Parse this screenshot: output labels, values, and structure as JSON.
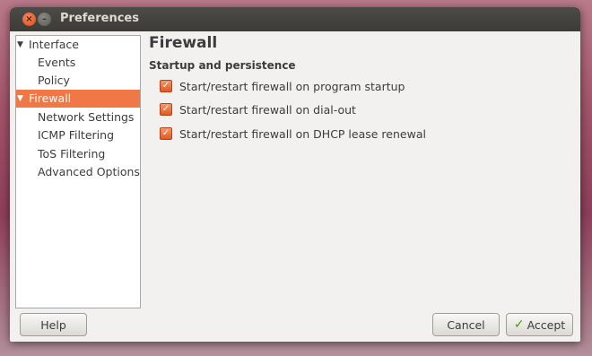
{
  "window": {
    "title": "Preferences"
  },
  "sidebar": {
    "items": [
      {
        "label": "Interface",
        "level": 0,
        "expanded": true,
        "selected": false
      },
      {
        "label": "Events",
        "level": 1,
        "selected": false
      },
      {
        "label": "Policy",
        "level": 1,
        "selected": false
      },
      {
        "label": "Firewall",
        "level": 0,
        "expanded": true,
        "selected": true
      },
      {
        "label": "Network Settings",
        "level": 1,
        "selected": false
      },
      {
        "label": "ICMP Filtering",
        "level": 1,
        "selected": false
      },
      {
        "label": "ToS Filtering",
        "level": 1,
        "selected": false
      },
      {
        "label": "Advanced Options",
        "level": 1,
        "selected": false
      }
    ],
    "expander_icon": "triangle-down-icon"
  },
  "main": {
    "heading": "Firewall",
    "section": "Startup and persistence",
    "options": [
      {
        "label": "Start/restart firewall on program startup",
        "checked": true
      },
      {
        "label": "Start/restart firewall on dial-out",
        "checked": true
      },
      {
        "label": "Start/restart firewall on DHCP lease renewal",
        "checked": true
      }
    ]
  },
  "buttons": {
    "help": "Help",
    "cancel": "Cancel",
    "accept": "Accept",
    "accept_icon": "checkmark-icon"
  },
  "colors": {
    "accent": "#f07746",
    "titlebar": "#3c3b37",
    "window_bg": "#f2f1f0"
  }
}
